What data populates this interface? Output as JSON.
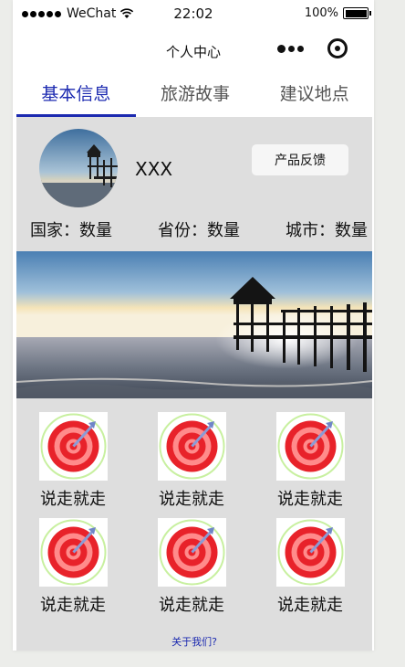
{
  "status_bar": {
    "carrier": "WeChat",
    "time": "22:02",
    "battery": "100%"
  },
  "nav": {
    "title": "个人中心",
    "more_icon": "more-dots-icon",
    "record_icon": "record-icon"
  },
  "tabs": [
    {
      "label": "基本信息",
      "active": true
    },
    {
      "label": "旅游故事",
      "active": false
    },
    {
      "label": "建议地点",
      "active": false
    }
  ],
  "profile": {
    "username": "XXX",
    "feedback_label": "产品反馈"
  },
  "stats": [
    {
      "label": "国家",
      "value": "数量"
    },
    {
      "label": "省份",
      "value": "数量"
    },
    {
      "label": "城市",
      "value": "数量"
    }
  ],
  "grid_items": [
    {
      "label": "说走就走",
      "icon": "target-icon"
    },
    {
      "label": "说走就走",
      "icon": "target-icon"
    },
    {
      "label": "说走就走",
      "icon": "target-icon"
    },
    {
      "label": "说走就走",
      "icon": "target-icon"
    },
    {
      "label": "说走就走",
      "icon": "target-icon"
    },
    {
      "label": "说走就走",
      "icon": "target-icon"
    }
  ],
  "footer": {
    "about_label": "关于我们?"
  },
  "colors": {
    "accent": "#1c2ab0",
    "content_bg": "#dedede"
  }
}
